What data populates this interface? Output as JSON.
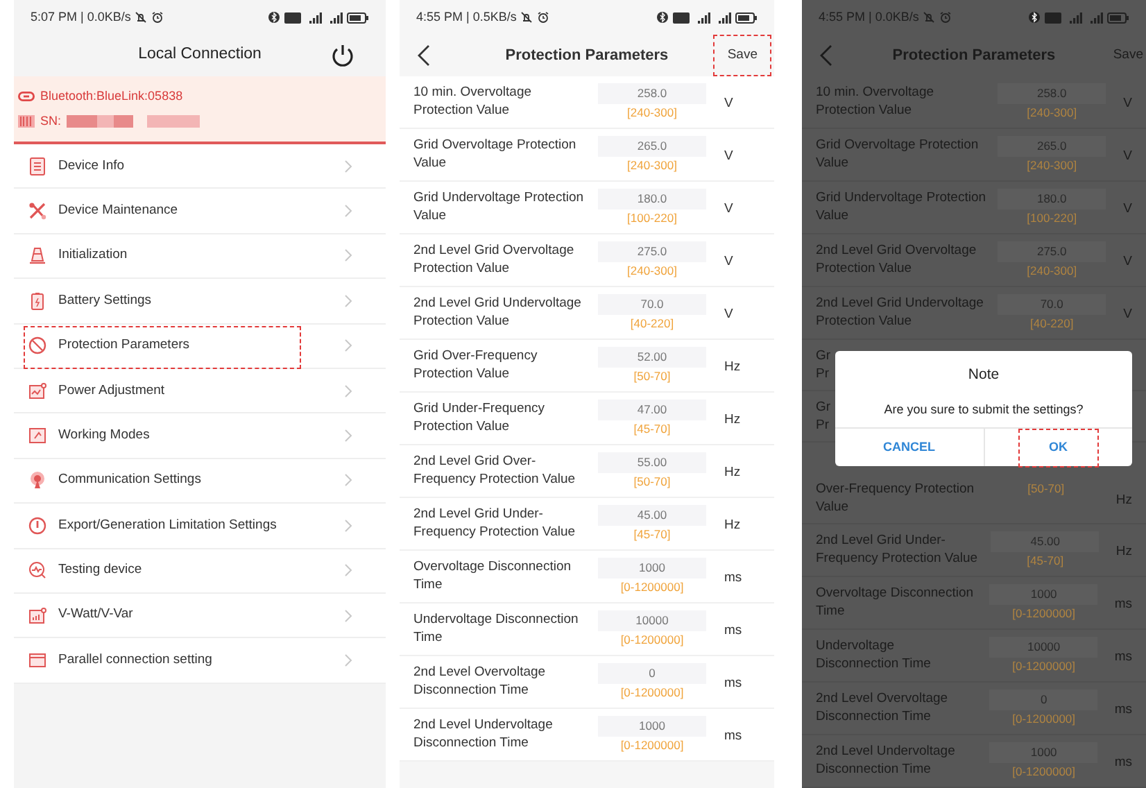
{
  "screens": [
    {
      "kind": "menu",
      "status_bar": {
        "text": "5:07 PM | 0.0KB/s"
      },
      "header": {
        "title": "Local Connection"
      },
      "connection": {
        "bluetooth": "Bluetooth:BlueLink:05838",
        "sn_label": "SN:"
      },
      "items": [
        {
          "label": "Device Info",
          "highlighted": false
        },
        {
          "label": "Device Maintenance",
          "highlighted": false
        },
        {
          "label": "Initialization",
          "highlighted": false
        },
        {
          "label": "Battery Settings",
          "highlighted": false
        },
        {
          "label": "Protection Parameters",
          "highlighted": true
        },
        {
          "label": "Power Adjustment",
          "highlighted": false
        },
        {
          "label": "Working Modes",
          "highlighted": false
        },
        {
          "label": "Communication Settings",
          "highlighted": false
        },
        {
          "label": "Export/Generation Limitation Settings",
          "highlighted": false
        },
        {
          "label": "Testing device",
          "highlighted": false
        },
        {
          "label": "V-Watt/V-Var",
          "highlighted": false
        },
        {
          "label": "Parallel connection setting",
          "highlighted": false
        }
      ]
    },
    {
      "kind": "params",
      "dimmed": false,
      "status_bar": {
        "text": "4:55 PM | 0.5KB/s"
      },
      "header": {
        "title": "Protection Parameters",
        "action": "Save",
        "action_highlighted": true
      },
      "rows": [
        {
          "label": "10 min. Overvoltage Protection Value",
          "value": "258.0",
          "range": "[240-300]",
          "unit": "V"
        },
        {
          "label": "Grid Overvoltage Protection Value",
          "value": "265.0",
          "range": "[240-300]",
          "unit": "V"
        },
        {
          "label": "Grid Undervoltage Protection Value",
          "value": "180.0",
          "range": "[100-220]",
          "unit": "V"
        },
        {
          "label": "2nd Level Grid Overvoltage Protection Value",
          "value": "275.0",
          "range": "[240-300]",
          "unit": "V"
        },
        {
          "label": "2nd Level Grid Undervoltage Protection Value",
          "value": "70.0",
          "range": "[40-220]",
          "unit": "V"
        },
        {
          "label": "Grid Over-Frequency Protection Value",
          "value": "52.00",
          "range": "[50-70]",
          "unit": "Hz"
        },
        {
          "label": "Grid Under-Frequency Protection Value",
          "value": "47.00",
          "range": "[45-70]",
          "unit": "Hz"
        },
        {
          "label": "2nd Level Grid Over-Frequency Protection Value",
          "value": "55.00",
          "range": "[50-70]",
          "unit": "Hz"
        },
        {
          "label": "2nd Level Grid Under-Frequency Protection Value",
          "value": "45.00",
          "range": "[45-70]",
          "unit": "Hz"
        },
        {
          "label": "Overvoltage Disconnection Time",
          "value": "1000",
          "range": "[0-1200000]",
          "unit": "ms"
        },
        {
          "label": "Undervoltage Disconnection Time",
          "value": "10000",
          "range": "[0-1200000]",
          "unit": "ms"
        },
        {
          "label": "2nd Level Overvoltage Disconnection Time",
          "value": "0",
          "range": "[0-1200000]",
          "unit": "ms"
        },
        {
          "label": "2nd Level Undervoltage Disconnection Time",
          "value": "1000",
          "range": "[0-1200000]",
          "unit": "ms"
        }
      ]
    },
    {
      "kind": "params",
      "dimmed": true,
      "status_bar": {
        "text": "4:55 PM | 0.0KB/s"
      },
      "header": {
        "title": "Protection Parameters",
        "action": "Save",
        "action_highlighted": false
      },
      "rows": [
        {
          "label": "10 min. Overvoltage Protection Value",
          "value": "258.0",
          "range": "[240-300]",
          "unit": "V"
        },
        {
          "label": "Grid Overvoltage Protection Value",
          "value": "265.0",
          "range": "[240-300]",
          "unit": "V"
        },
        {
          "label": "Grid Undervoltage Protection Value",
          "value": "180.0",
          "range": "[100-220]",
          "unit": "V"
        },
        {
          "label": "2nd Level Grid Overvoltage Protection Value",
          "value": "275.0",
          "range": "[240-300]",
          "unit": "V"
        },
        {
          "label": "2nd Level Grid Undervoltage Protection Value",
          "value": "70.0",
          "range": "[40-220]",
          "unit": "V"
        },
        {
          "label": "Gr\nPr"
        },
        {
          "label": "Gr\nPr"
        },
        {
          "label": "Over-Frequency Protection Value",
          "range": "[50-70]",
          "unit": "Hz"
        },
        {
          "label": "2nd Level Grid Under-Frequency Protection Value",
          "value": "45.00",
          "range": "[45-70]",
          "unit": "Hz"
        },
        {
          "label": "Overvoltage Disconnection Time",
          "value": "1000",
          "range": "[0-1200000]",
          "unit": "ms"
        },
        {
          "label": "Undervoltage Disconnection Time",
          "value": "10000",
          "range": "[0-1200000]",
          "unit": "ms"
        },
        {
          "label": "2nd Level Overvoltage Disconnection Time",
          "value": "0",
          "range": "[0-1200000]",
          "unit": "ms"
        },
        {
          "label": "2nd Level Undervoltage Disconnection Time",
          "value": "1000",
          "range": "[0-1200000]",
          "unit": "ms"
        }
      ],
      "dialog": {
        "title": "Note",
        "message": "Are you sure to submit the settings?",
        "buttons": [
          {
            "label": "CANCEL",
            "highlighted": false
          },
          {
            "label": "OK",
            "highlighted": true
          }
        ]
      }
    }
  ]
}
